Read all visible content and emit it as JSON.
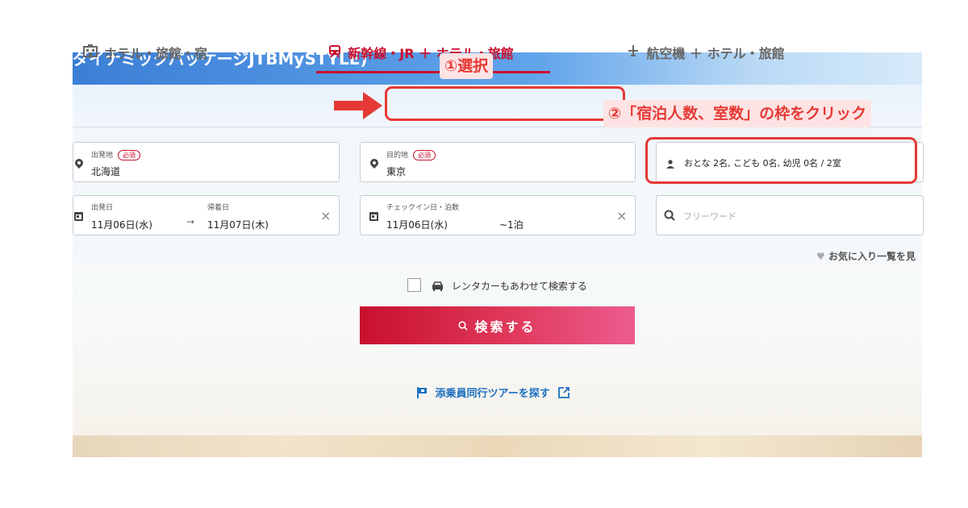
{
  "header": {
    "brand_text": "ダイナミックパッケージJTBMySTYLE)"
  },
  "tabs": [
    {
      "label": "ホテル・旅館・宿",
      "icon": "building-icon"
    },
    {
      "label": "新幹線・JR ＋ ホテル・旅館",
      "icon": "train-icon"
    },
    {
      "label": "航空機 ＋ ホテル・旅館",
      "icon": "plane-icon"
    }
  ],
  "annotations": {
    "callout1": "①選択",
    "callout2": "②「宿泊人数、室数」の枠をクリック",
    "highlight_color": "#e53935"
  },
  "form": {
    "departure": {
      "label": "出発地",
      "required": "必須",
      "value": "北海道"
    },
    "destination": {
      "label": "目的地",
      "required": "必須",
      "value": "東京"
    },
    "guests": {
      "value": "おとな 2名, こども 0名, 幼児 0名 / 2室"
    },
    "depart_date": {
      "label": "出発日",
      "value": "11月06日(水)"
    },
    "return_date": {
      "label": "帰着日",
      "value": "11月07日(木)"
    },
    "date_arrow": "→",
    "checkin": {
      "label": "チェックイン日・泊数",
      "date": "11月06日(水)",
      "nights": "~1泊"
    },
    "freeword": {
      "placeholder": "フリーワード"
    },
    "clear_symbol": "×"
  },
  "favorites": "お気に入り一覧を見",
  "rentacar": {
    "label": "レンタカーもあわせて検索する",
    "checked": false
  },
  "search_button": {
    "label": "検索する"
  },
  "tour_link": "添乗員同行ツアーを探す",
  "colors": {
    "accent": "#c8102e",
    "link": "#1f6fc0"
  }
}
